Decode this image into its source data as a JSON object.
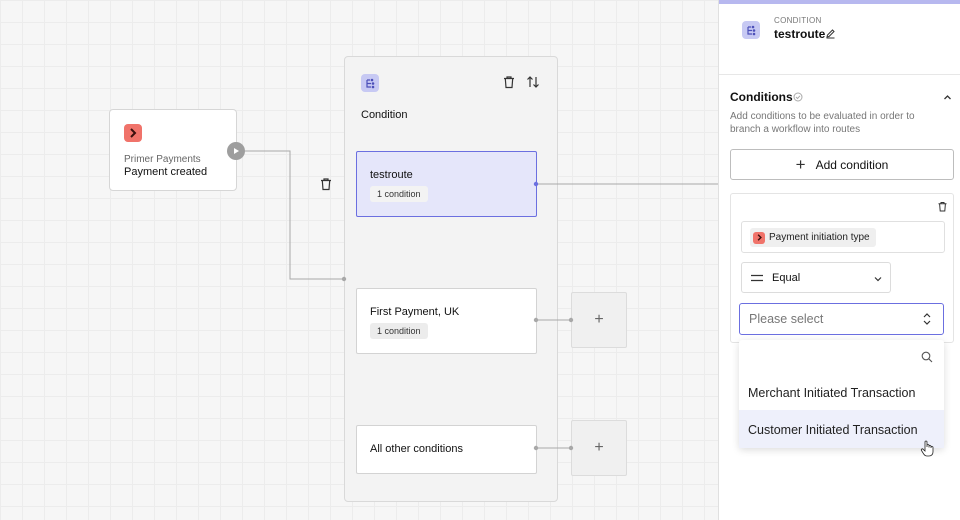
{
  "trigger": {
    "provider": "Primer Payments",
    "event": "Payment created",
    "icon": "primer-logo-icon",
    "color": "#f0736a"
  },
  "condition_node": {
    "title": "Condition",
    "icon": "branch-icon",
    "routes": [
      {
        "name": "testroute",
        "badge": "1 condition",
        "selected": true
      },
      {
        "name": "First Payment, UK",
        "badge": "1 condition",
        "selected": false
      },
      {
        "name": "All other conditions",
        "badge": "",
        "selected": false
      }
    ],
    "add_step_label": "+"
  },
  "panel": {
    "kicker": "CONDITION",
    "name": "testroute",
    "section_title": "Conditions",
    "section_desc": "Add conditions to be evaluated in order to branch a workflow into routes",
    "add_condition_label": "Add condition",
    "rule": {
      "field": "Payment initiation type",
      "operator": "Equal",
      "value_placeholder": "Please select"
    },
    "dropdown_options": [
      "Merchant Initiated Transaction",
      "Customer Initiated Transaction"
    ]
  },
  "colors": {
    "accent": "#6b6fe0",
    "selected_bg": "#e5e6fa",
    "brand": "#f0736a"
  }
}
